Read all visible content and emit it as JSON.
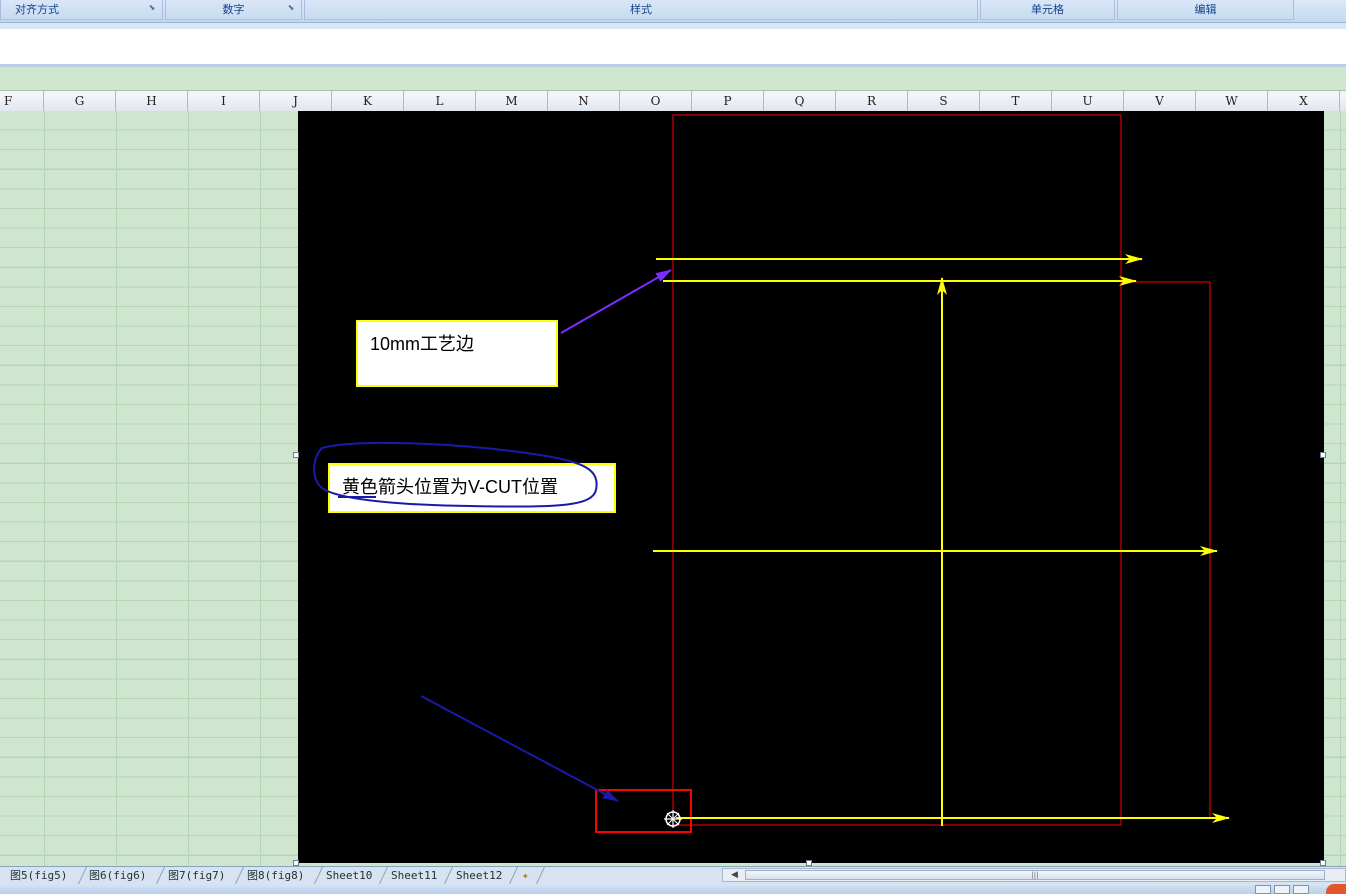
{
  "ribbon": {
    "groups": [
      "对齐方式",
      "数字",
      "样式",
      "单元格",
      "编辑"
    ]
  },
  "columns": [
    "F",
    "G",
    "H",
    "I",
    "J",
    "K",
    "L",
    "M",
    "N",
    "O",
    "P",
    "Q",
    "R",
    "S",
    "T",
    "U",
    "V",
    "W",
    "X"
  ],
  "drawing": {
    "callout_process_edge": "10mm工艺边",
    "callout_vcut": "黄色箭头位置为V-CUT位置"
  },
  "sheet_tabs": [
    "图5(fig5)",
    "图6(fig6)",
    "图7(fig7)",
    "图8(fig8)",
    "Sheet10",
    "Sheet11",
    "Sheet12"
  ],
  "colors": {
    "arrow": "#ffff00",
    "board_outline": "#ff0000",
    "pointer_arrow": "#7b2cff",
    "annotation_pen": "#1a1aaa"
  }
}
